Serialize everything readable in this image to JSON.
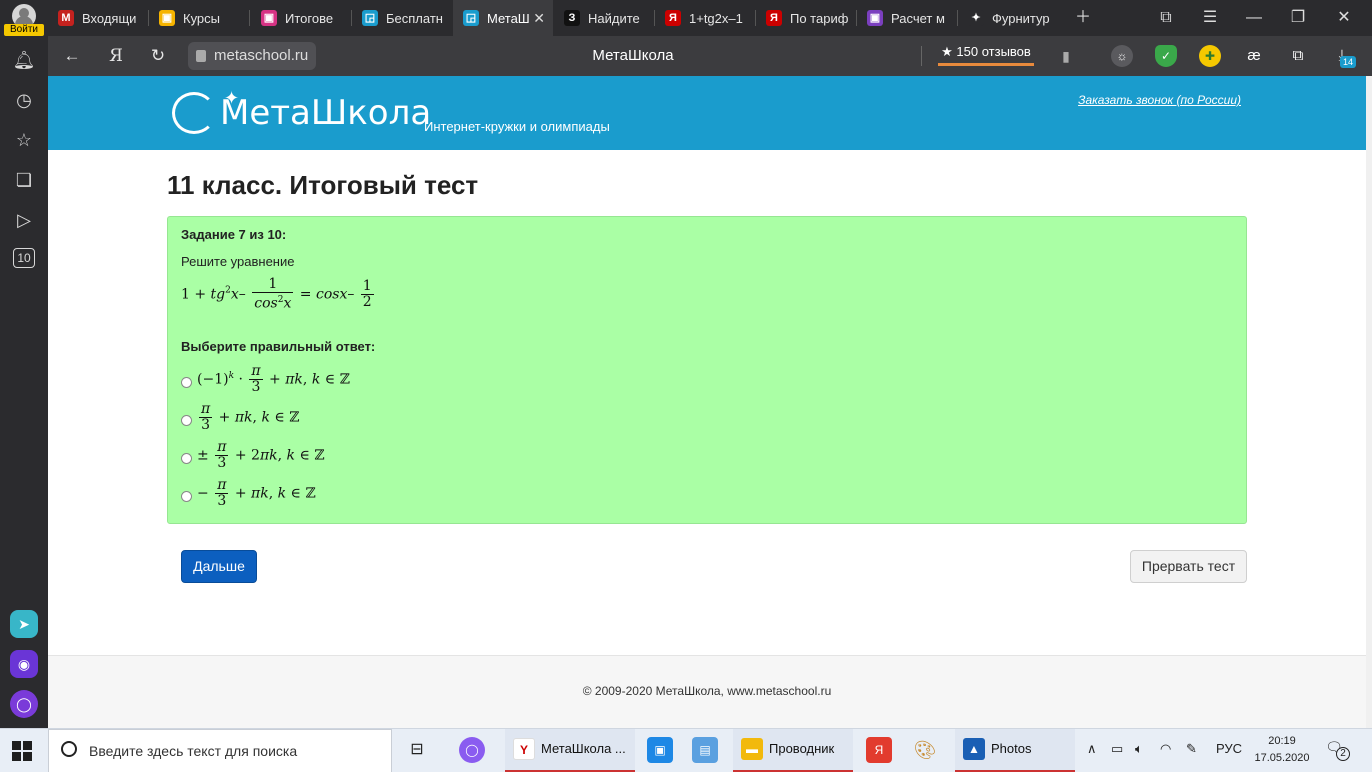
{
  "browser": {
    "profile_label": "Войти",
    "tabs": [
      {
        "title": "Входящи",
        "icon": "gmail-icon",
        "color": "#c5221f",
        "glyph": "M"
      },
      {
        "title": "Курсы",
        "icon": "classroom-icon",
        "color": "#f6b400",
        "glyph": "▣"
      },
      {
        "title": "Итогове",
        "icon": "pink-square-icon",
        "color": "#d63384",
        "glyph": "▣"
      },
      {
        "title": "Бесплатн",
        "icon": "metaschool-icon",
        "color": "#1a9ccd",
        "glyph": "◲"
      },
      {
        "title": "МетаШ",
        "icon": "metaschool-icon",
        "color": "#1a9ccd",
        "glyph": "◲"
      },
      {
        "title": "Найдите",
        "icon": "znanija-icon",
        "color": "#111111",
        "glyph": "З"
      },
      {
        "title": "1+tg2x–1",
        "icon": "yandex-icon",
        "color": "#cc0000",
        "glyph": "Я"
      },
      {
        "title": "По тариф",
        "icon": "yandex-icon",
        "color": "#cc0000",
        "glyph": "Я"
      },
      {
        "title": "Расчет м",
        "icon": "purple-square-icon",
        "color": "#7b3fbf",
        "glyph": "▣"
      },
      {
        "title": "Фурнитур",
        "icon": "sparkle-icon",
        "color": "#2b2b2e",
        "glyph": "✦"
      }
    ],
    "url": "metaschool.ru",
    "page_title": "МетаШкола",
    "reviews": "★ 150 отзывов",
    "downloads_badge": "14"
  },
  "sidebar": {
    "calendar_label": "10"
  },
  "site": {
    "logo": "МетаШкола",
    "tagline": "Интернет-кружки и олимпиады",
    "callback": "Заказать звонок (по России)"
  },
  "test": {
    "heading": "11 класс. Итоговый тест",
    "task_number": "Задание 7 из 10:",
    "task_text": "Решите уравнение",
    "choose_label": "Выберите правильный ответ:",
    "next_button": "Дальше",
    "stop_button": "Прервать тест"
  },
  "footer": {
    "text": "© 2009-2020 МетаШкола, www.metaschool.ru"
  },
  "taskbar": {
    "search_placeholder": "Введите здесь текст для поиска",
    "apps": [
      {
        "label": "МетаШкола ...",
        "icon": "yandex-browser-icon"
      },
      {
        "label": "Проводник",
        "icon": "folder-icon"
      },
      {
        "label": "Photos",
        "icon": "photos-icon"
      }
    ],
    "language": "РУС",
    "time": "20:19",
    "date": "17.05.2020",
    "notifications": "2"
  }
}
